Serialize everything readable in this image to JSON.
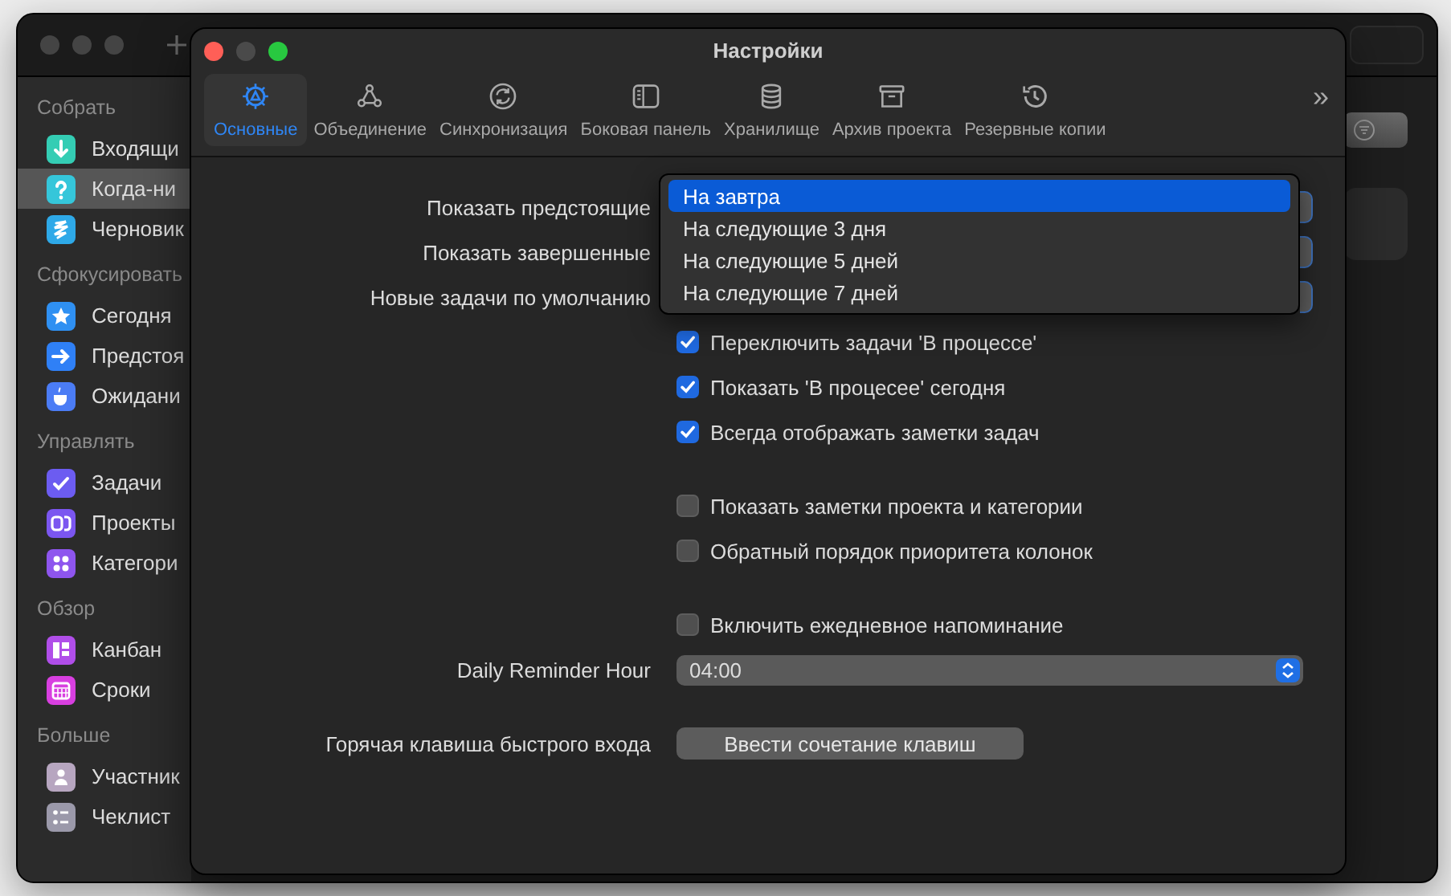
{
  "background_window": {
    "sidebar": {
      "sections": [
        {
          "title": "Собрать",
          "items": [
            {
              "label": "Входящи",
              "selected": false,
              "color": "#34cdb4"
            },
            {
              "label": "Когда-ни",
              "selected": true,
              "color": "#35c6da"
            },
            {
              "label": "Черновик",
              "selected": false,
              "color": "#2ea9e8"
            }
          ]
        },
        {
          "title": "Сфокусировать",
          "items": [
            {
              "label": "Сегодня",
              "selected": false,
              "color": "#2f90f2"
            },
            {
              "label": "Предстоя",
              "selected": false,
              "color": "#2f80f6"
            },
            {
              "label": "Ожидани",
              "selected": false,
              "color": "#4b7cf5"
            }
          ]
        },
        {
          "title": "Управлять",
          "items": [
            {
              "label": "Задачи",
              "selected": false,
              "color": "#6c5cf1"
            },
            {
              "label": "Проекты",
              "selected": false,
              "color": "#7b56f0"
            },
            {
              "label": "Категори",
              "selected": false,
              "color": "#8e55ee"
            }
          ]
        },
        {
          "title": "Обзор",
          "items": [
            {
              "label": "Канбан",
              "selected": false,
              "color": "#b04ee9"
            },
            {
              "label": "Сроки",
              "selected": false,
              "color": "#d83fe0"
            }
          ]
        },
        {
          "title": "Больше",
          "items": [
            {
              "label": "Участник",
              "selected": false,
              "color": "#b7a6c0"
            },
            {
              "label": "Чеклист",
              "selected": false,
              "color": "#9b99aa"
            }
          ]
        }
      ]
    }
  },
  "settings_window": {
    "title": "Настройки",
    "tabs": [
      {
        "label": "Основные",
        "selected": true
      },
      {
        "label": "Объединение",
        "selected": false
      },
      {
        "label": "Синхронизация",
        "selected": false
      },
      {
        "label": "Боковая панель",
        "selected": false
      },
      {
        "label": "Хранилище",
        "selected": false
      },
      {
        "label": "Архив проекта",
        "selected": false
      },
      {
        "label": "Резервные копии",
        "selected": false
      }
    ],
    "overflow": "»",
    "groups": [
      {
        "rows": [
          {
            "kind": "popup",
            "label": "Показать предстоящие",
            "menu": [
              {
                "label": "На завтра",
                "selected": true
              },
              {
                "label": "На следующие 3 дня",
                "selected": false
              },
              {
                "label": "На следующие 5 дней",
                "selected": false
              },
              {
                "label": "На следующие 7 дней",
                "selected": false
              }
            ]
          },
          {
            "kind": "popup",
            "label": "Показать завершенные"
          },
          {
            "kind": "popup",
            "label": "Новые задачи по умолчанию"
          },
          {
            "kind": "checkbox",
            "label": "Переключить задачи 'В процессе'",
            "checked": true
          },
          {
            "kind": "checkbox",
            "label": "Показать 'В процесее' сегодня",
            "checked": true
          },
          {
            "kind": "checkbox",
            "label": "Всегда отображать заметки задач",
            "checked": true
          }
        ]
      },
      {
        "rows": [
          {
            "kind": "checkbox",
            "label": "Показать заметки проекта и категории",
            "checked": false
          },
          {
            "kind": "checkbox",
            "label": "Обратный порядок приоритета колонок",
            "checked": false
          }
        ]
      },
      {
        "rows": [
          {
            "kind": "checkbox",
            "label": "Включить ежедневное напоминание",
            "checked": false
          },
          {
            "kind": "select",
            "label": "Daily Reminder Hour",
            "value": "04:00"
          }
        ]
      },
      {
        "rows": [
          {
            "kind": "shortcut",
            "label": "Горячая клавиша быстрого входа",
            "button": "Ввести сочетание клавиш"
          }
        ]
      }
    ]
  }
}
